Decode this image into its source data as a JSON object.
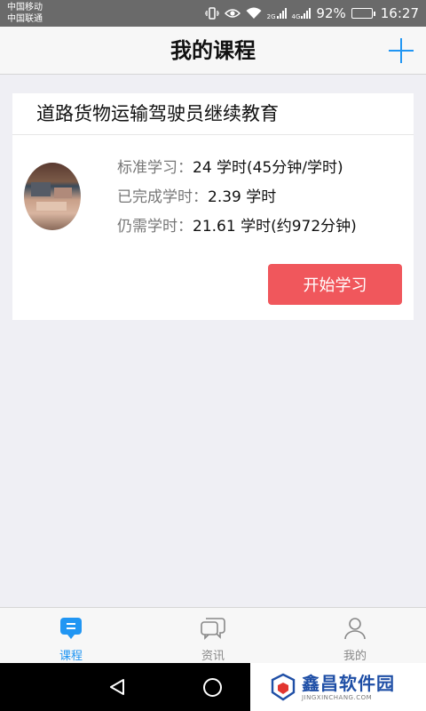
{
  "status_bar": {
    "carrier_1": "中国移动",
    "carrier_2": "中国联通",
    "net_tag_1": "2G",
    "net_tag_2": "4G",
    "battery": "92%",
    "battery_level": 0.92,
    "time": "16:27"
  },
  "header": {
    "title": "我的课程",
    "add_icon": "plus-icon"
  },
  "course": {
    "title": "道路货物运输驾驶员继续教育",
    "rows": [
      {
        "label": "标准学习：",
        "value": "24 学时(45分钟/学时)"
      },
      {
        "label": "已完成学时：",
        "value": "2.39 学时"
      },
      {
        "label": "仍需学时：",
        "value": "21.61 学时(约972分钟)"
      }
    ],
    "start_button": "开始学习"
  },
  "tabs": [
    {
      "label": "课程",
      "icon": "course-icon",
      "active": true
    },
    {
      "label": "资讯",
      "icon": "chat-bubbles-icon",
      "active": false
    },
    {
      "label": "我的",
      "icon": "person-icon",
      "active": false
    }
  ],
  "watermark": {
    "name": "鑫昌软件园",
    "url": "JINGXINCHANG.COM"
  },
  "colors": {
    "accent": "#2196f3",
    "start_button": "#f0575c",
    "status_bar": "#6a6a6a"
  }
}
